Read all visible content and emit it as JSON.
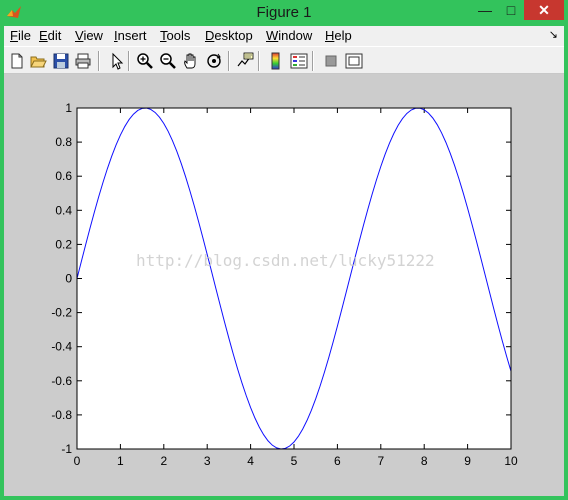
{
  "window": {
    "title": "Figure 1"
  },
  "menu": [
    "File",
    "Edit",
    "View",
    "Insert",
    "Tools",
    "Desktop",
    "Window",
    "Help"
  ],
  "menu_mnemonic_index": [
    0,
    0,
    0,
    0,
    0,
    0,
    0,
    0
  ],
  "menu_dock_icon": "dock-arrow-icon",
  "toolbar": [
    "new-figure-icon",
    "open-file-icon",
    "save-icon",
    "print-icon",
    "edit-plot-icon",
    "zoom-in-icon",
    "zoom-out-icon",
    "pan-icon",
    "rotate-3d-icon",
    "data-cursor-icon",
    "colorbar-icon",
    "legend-icon",
    "hide-plot-tools-icon",
    "show-plot-tools-icon"
  ],
  "watermark": "http://blog.csdn.net/lucky51222",
  "colors": {
    "line": "#1010ff",
    "figure_bg": "#cccccc",
    "axes_bg": "#ffffff",
    "titlebar": "#33c35c"
  },
  "chart_data": {
    "type": "line",
    "title": "",
    "xlabel": "",
    "ylabel": "",
    "xlim": [
      0,
      10
    ],
    "ylim": [
      -1,
      1
    ],
    "xticks": [
      "0",
      "1",
      "2",
      "3",
      "4",
      "5",
      "6",
      "7",
      "8",
      "9",
      "10"
    ],
    "yticks": [
      "1",
      "0.8",
      "0.6",
      "0.4",
      "0.2",
      "0",
      "-0.2",
      "-0.4",
      "-0.6",
      "-0.8",
      "-1"
    ],
    "grid": false,
    "series": [
      {
        "function": "y = sin(x)",
        "x_start": 0,
        "x_end": 10,
        "points": 101,
        "color": "#1010ff"
      }
    ]
  }
}
